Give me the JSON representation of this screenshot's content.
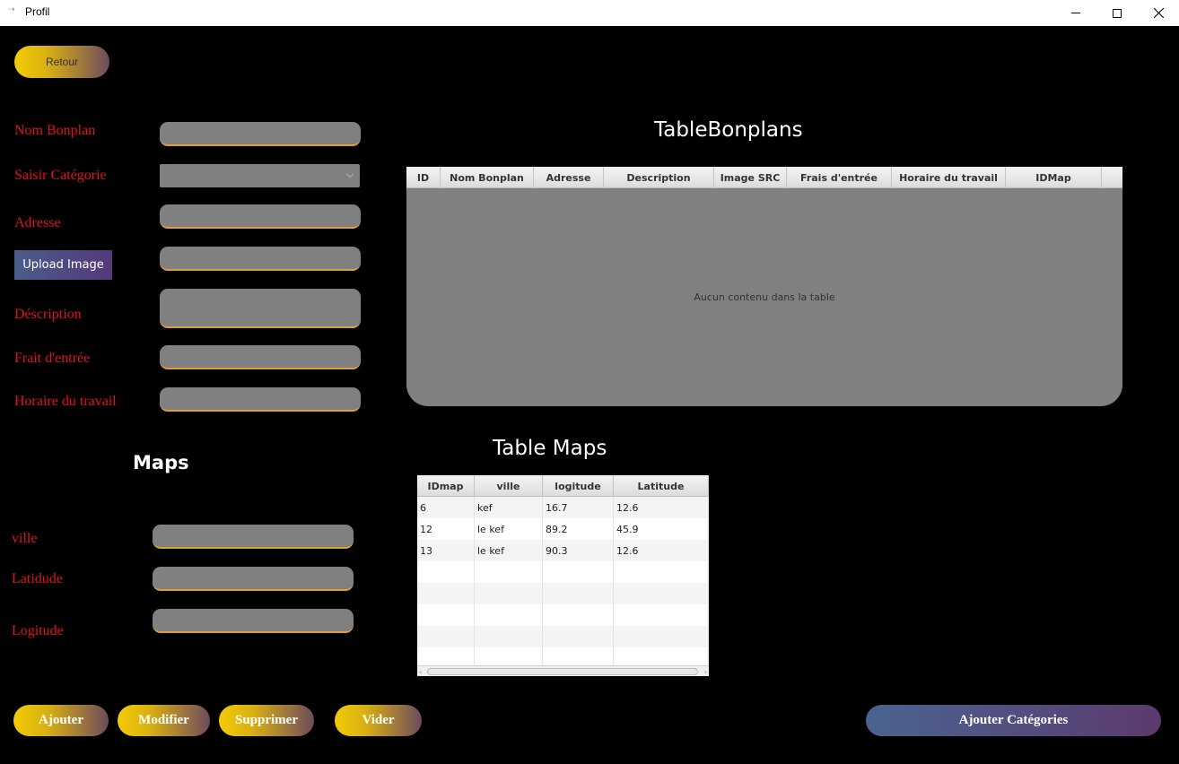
{
  "window": {
    "title": "Profil",
    "app_icon": "java-icon"
  },
  "retour_label": "Retour",
  "form": {
    "nom_label": "Nom Bonplan",
    "categorie_label": "Saisir Catégorie",
    "adresse_label": "Adresse",
    "upload_label": "Upload Image",
    "description_label": "Déscription",
    "frais_label": "Frait d'entrée",
    "horaire_label": "Horaire du travail"
  },
  "bonplans_table": {
    "title": "TableBonplans",
    "columns": [
      "ID",
      "Nom Bonplan",
      "Adresse",
      "Description",
      "Image SRC",
      "Frais d'entrée",
      "Horaire du travail",
      "IDMap"
    ],
    "empty_text": "Aucun contenu dans la table"
  },
  "maps": {
    "title": "Maps",
    "ville_label": "ville",
    "latitude_label": "Latidude",
    "longitude_label": "Logitude"
  },
  "maps_table": {
    "title": "Table Maps",
    "columns": [
      "IDmap",
      "ville",
      "logitude",
      "Latitude"
    ],
    "rows": [
      [
        "6",
        "kef",
        "16.7",
        "12.6"
      ],
      [
        "12",
        "le kef",
        "89.2",
        "45.9"
      ],
      [
        "13",
        "le kef",
        "90.3",
        "12.6"
      ]
    ]
  },
  "actions": {
    "ajouter": "Ajouter",
    "modifier": "Modifier",
    "supprimer": "Supprimer",
    "vider": "Vider",
    "ajouter_categories": "Ajouter Catégories"
  },
  "colors": {
    "background": "#000000",
    "label_red": "#e0141c",
    "field_gray": "#808080",
    "field_underline": "#e0a030",
    "gold": "#f2cb05",
    "purple": "#5c3a6e"
  }
}
